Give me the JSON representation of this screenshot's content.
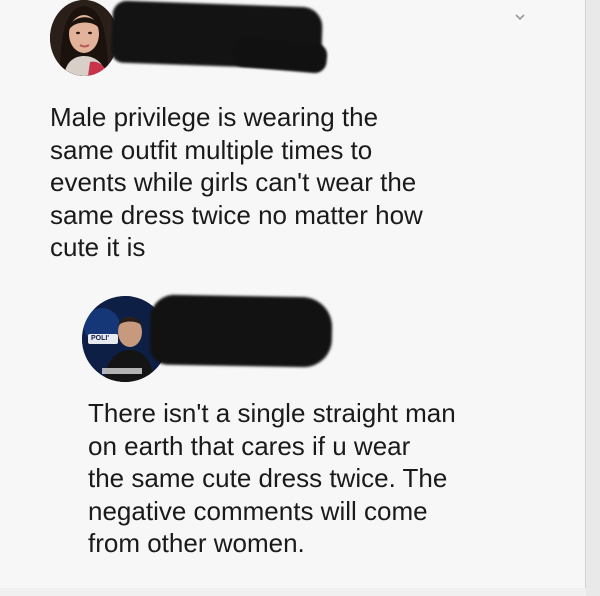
{
  "post": {
    "text": "Male privilege is wearing the\nsame outfit multiple times to\nevents while girls can't wear the\nsame dress twice  no matter how\ncute it is",
    "menu_icon": "chevron-down-icon"
  },
  "reply": {
    "text": "There isn't a single straight man\non earth that cares if u wear\nthe same cute dress twice. The\nnegative comments will come\nfrom other women.",
    "avatar_badge": "POLI'"
  },
  "colors": {
    "background": "#f7f7f7",
    "text": "#1a1a1a",
    "redaction": "#121212"
  }
}
